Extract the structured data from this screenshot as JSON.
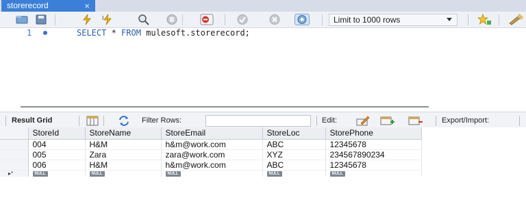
{
  "tab": {
    "title": "storerecord",
    "close": "×"
  },
  "toolbar": {
    "icons": [
      "folder-icon",
      "save-icon",
      "execute-icon",
      "execute-current-icon",
      "explain-icon",
      "stop-icon",
      "toggle-error-icon",
      "commit-icon",
      "rollback-icon",
      "autocommit-icon",
      "bookmark-icon",
      "beautify-icon"
    ],
    "limit": "Limit to 1000 rows"
  },
  "editor": {
    "line_number": "1",
    "sql_keywords": [
      "SELECT",
      "FROM"
    ],
    "sql_text": {
      "select": "SELECT",
      "star": " * ",
      "from": "FROM",
      "rest": " mulesoft.storerecord;"
    }
  },
  "result_toolbar": {
    "result_grid": "Result Grid",
    "filter_rows": "Filter Rows:",
    "edit": "Edit:",
    "export_import": "Export/Import:"
  },
  "grid": {
    "columns": [
      "StoreId",
      "StoreName",
      "StoreEmail",
      "StoreLoc",
      "StorePhone"
    ],
    "rows": [
      [
        "004",
        "H&M",
        "h&m@work.com",
        "ABC",
        "12345678"
      ],
      [
        "005",
        "Zara",
        "zara@work.com",
        "XYZ",
        "234567890234"
      ],
      [
        "006",
        "H&M",
        "h&m@work.com",
        "ABC",
        "12345678"
      ]
    ],
    "null_label": "NULL",
    "new_row_marker": "▸*"
  }
}
